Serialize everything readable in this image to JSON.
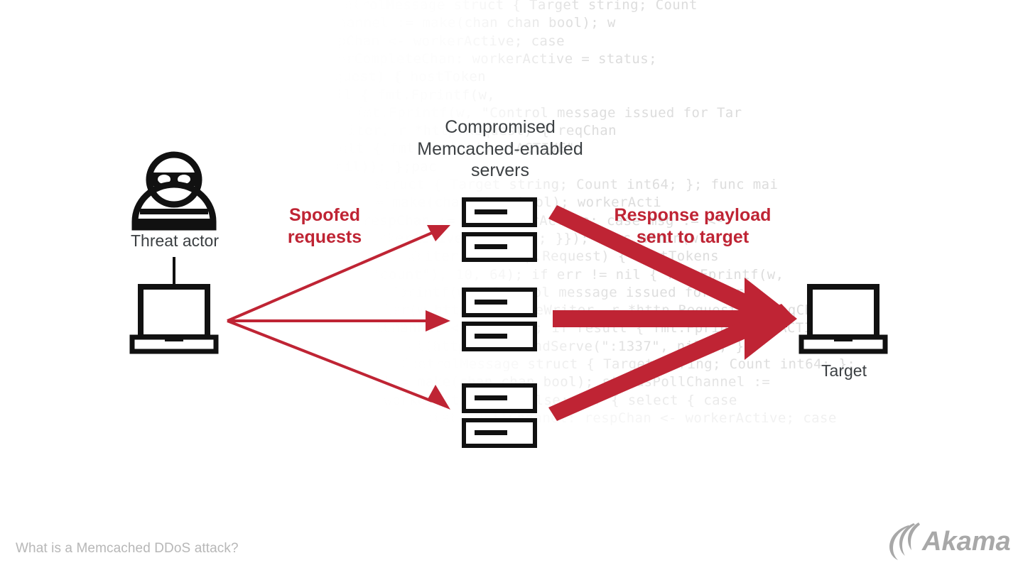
{
  "colors": {
    "red": "#bf2434",
    "red_dark": "#b01f2e",
    "ink": "#3c4043",
    "icon_black": "#111111",
    "code_grey": "#dcdcdc",
    "footer_grey": "#b7b7b7",
    "logo_grey": "#a8a8a8",
    "background": "#ffffff"
  },
  "diagram": {
    "title": "What is a Memcached DDoS attack?",
    "nodes": {
      "threat_actor": {
        "label": "Threat actor",
        "icon": "burglar-icon",
        "device_icon": "laptop-icon"
      },
      "servers": {
        "label": "Compromised Memcached-enabled servers",
        "label_lines": [
          "Compromised",
          "Memcached-enabled",
          "servers"
        ],
        "icon": "server-icon",
        "group_count": 3,
        "servers_per_group": 2,
        "total": 6
      },
      "target": {
        "label": "Target",
        "device_icon": "laptop-icon"
      }
    },
    "flows": [
      {
        "id": "spoofed-requests",
        "label": "Spoofed requests",
        "label_lines": [
          "Spoofed",
          "requests"
        ],
        "from": "threat_actor",
        "to": "servers",
        "style": "thin-arrow",
        "count": 3,
        "color": "#bf2434"
      },
      {
        "id": "response-payload",
        "label": "Response payload sent to target",
        "label_lines": [
          "Response payload",
          "sent to target"
        ],
        "from": "servers",
        "to": "target",
        "style": "thick-arrow",
        "count": 3,
        "color": "#bf2434"
      }
    ]
  },
  "footer": {
    "caption": "What is a Memcached DDoS attack?",
    "logo_text": "Akamai",
    "logo_mark": "akamai-swoosh-icon"
  },
  "background_code": {
    "language": "go",
    "lines": [
      "workerActive bool; Timestamp \"time\" }; type ControlMessage struct { Target string; Count",
      "int64; }; func main() { controlChannel = make(chan chan bool); statusPollChannel := make(chan chan bool); w",
      "orkerActive := false; for { select { case respChan := <- statusPollChannel: respChan <- workerActive; case",
      "msg := <-controlChannel: workerActive = true; case status := <- workerCompleteChan: workerActive = status;",
      "func admin(w http.ResponseWriter, r *http.Request) { hostToken",
      "s := strings.Split(r.FormValue(\"count\"), 10, 64); if err != nil { fmt.Fprintf(w,",
      "\"Control message issued for Target\"); fmt.Fprintf(w, \"Control message issued for Tar",
      "get\"); func statusHandler(w http.ResponseWriter, r *http.Request) { reqChan",
      "make(chan bool); statusPollChannel <- reqChan; if result { fmt.Fprint(w, \"ACTIVE\"",
      "); }; log.Fatal(http.ListenAndServe(\":1337\", nil)); };pac",
      "kage main; type ControlMessage struct { Target string; Count int64; }; func mai",
      "n() { controlChannel = make(chan chan bool); workerActi",
      "ve := false; for { select { case respChan := <- workerActive; case msg := <-",
      "controlChannel: workerActive = status; }}); func admin(w",
      "http.ResponseWriter, r *http.Request) { hostTokens",
      "strconv.ParseInt(r.FormValue(\"count\"), 10, 64); if err != nil { fmt.Fprintf(w,",
      "\"error\"); } fmt.Fprintf(w, \"Control message issued for Tar",
      "get\"); func statusHandler(w http.ResponseWriter, r *http.Request) { reqChan",
      "make(chan bool); statusPollChannel <- reqChan; if result { fmt.Fprint(w, \"ACTIVE\"",
      "); }; log.Fatal(http.ListenAndServe(\":1337\", nil)); };",
      "package main; type ControlMessage struct { Target string; Count int64; };",
      "func main() { controlChannel = make(chan chan bool); statusPollChannel :=",
      "make(chan chan bool); workerActive := false; for { select { case",
      "respChan := <- statusPollChannel: respChan <- workerActive; case"
    ]
  }
}
